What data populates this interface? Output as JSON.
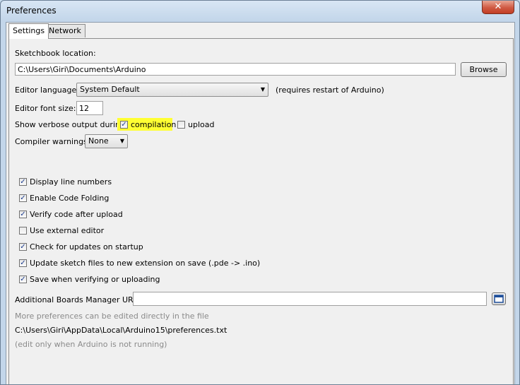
{
  "window": {
    "title": "Preferences",
    "close_glyph": "✕"
  },
  "tabs": [
    {
      "label": "Settings"
    },
    {
      "label": "Network"
    }
  ],
  "settings": {
    "sketchbook_label": "Sketchbook location:",
    "sketchbook_value": "C:\\Users\\Giri\\Documents\\Arduino",
    "browse_label": "Browse",
    "language_label": "Editor language:",
    "language_value": "System Default",
    "language_note": "(requires restart of Arduino)",
    "font_size_label": "Editor font size:",
    "font_size_value": "12",
    "verbose_label": "Show verbose output during:",
    "verbose_compilation_label": "compilation",
    "verbose_compilation_checked": true,
    "verbose_upload_label": "upload",
    "verbose_upload_checked": false,
    "warnings_label": "Compiler warnings:",
    "warnings_value": "None",
    "options": [
      {
        "label": "Display line numbers",
        "checked": true
      },
      {
        "label": "Enable Code Folding",
        "checked": true
      },
      {
        "label": "Verify code after upload",
        "checked": true
      },
      {
        "label": "Use external editor",
        "checked": false
      },
      {
        "label": "Check for updates on startup",
        "checked": true
      },
      {
        "label": "Update sketch files to new extension on save (.pde -> .ino)",
        "checked": true
      },
      {
        "label": "Save when verifying or uploading",
        "checked": true
      }
    ],
    "boards_urls_label": "Additional Boards Manager URLs:",
    "boards_urls_value": "",
    "more_prefs_note": "More preferences can be edited directly in the file",
    "prefs_path": "C:\\Users\\Giri\\AppData\\Local\\Arduino15\\preferences.txt",
    "edit_note": "(edit only when Arduino is not running)"
  },
  "colors": {
    "highlight": "#ffff33",
    "check": "#1d3d8f"
  },
  "icons": {
    "check": "✓",
    "dropdown": "▼"
  }
}
